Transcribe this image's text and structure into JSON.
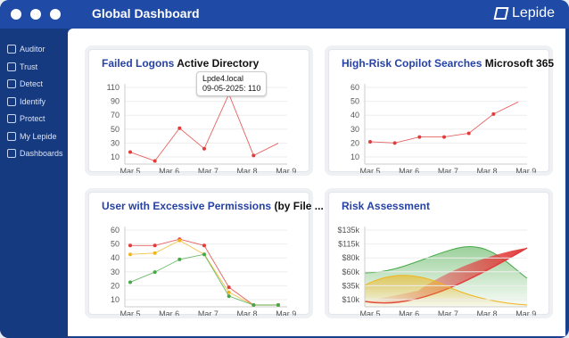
{
  "app": {
    "title": "Global Dashboard",
    "brand": "Lepide"
  },
  "sidebar": {
    "items": [
      {
        "label": "Auditor",
        "icon": "eye-icon"
      },
      {
        "label": "Trust",
        "icon": "shield-icon"
      },
      {
        "label": "Detect",
        "icon": "radar-icon"
      },
      {
        "label": "Identify",
        "icon": "id-card-icon"
      },
      {
        "label": "Protect",
        "icon": "lock-icon"
      },
      {
        "label": "My Lepide",
        "icon": "user-icon"
      },
      {
        "label": "Dashboards",
        "icon": "globe-icon"
      }
    ]
  },
  "cards": {
    "failed_logons": {
      "title": "Failed Logons",
      "subtitle": "Active Directory"
    },
    "copilot": {
      "title": "High-Risk Copilot Searches",
      "subtitle": "Microsoft 365"
    },
    "excessive": {
      "title": "User with Excessive Permissions",
      "subtitle": "(by File ..."
    },
    "risk": {
      "title": "Risk Assessment",
      "subtitle": ""
    }
  },
  "tooltip": {
    "line1": "Lpde4.local",
    "line2": "09-05-2025: 110"
  },
  "colors": {
    "red": "#e23b3b",
    "green": "#46a846",
    "yellow": "#f0b51e",
    "accent": "#2642a4"
  },
  "chart_data": [
    {
      "type": "line",
      "title": "Failed Logons",
      "xlabels": [
        "Mar 5",
        "Mar 6",
        "Mar 7",
        "Mar 8",
        "Mar 9"
      ],
      "yticks": [
        10,
        30,
        50,
        70,
        90,
        110
      ],
      "ylim": [
        0,
        115
      ],
      "series": [
        {
          "values": [
            15,
            2,
            50,
            20,
            100,
            10,
            28
          ]
        }
      ]
    },
    {
      "type": "line",
      "title": "High-Risk Copilot Searches",
      "xlabels": [
        "Mar 5",
        "Mar 6",
        "Mar 7",
        "Mar 8",
        "Mar 9"
      ],
      "yticks": [
        10,
        20,
        30,
        40,
        50,
        60
      ],
      "ylim": [
        0,
        65
      ],
      "series": [
        {
          "values": [
            17,
            16,
            21,
            21,
            24,
            40,
            50
          ]
        }
      ]
    },
    {
      "type": "line",
      "title": "User with Excessive Permissions",
      "xlabels": [
        "Mar 5",
        "Mar 6",
        "Mar 7",
        "Mar 8",
        "Mar 9"
      ],
      "yticks": [
        10,
        20,
        30,
        40,
        50,
        60
      ],
      "ylim": [
        0,
        62
      ],
      "series": [
        {
          "color": "red",
          "values": [
            47,
            47,
            52,
            47,
            14,
            0,
            0
          ]
        },
        {
          "color": "yellow",
          "values": [
            40,
            41,
            51,
            40,
            10,
            0,
            0
          ]
        },
        {
          "color": "green",
          "values": [
            18,
            26,
            36,
            40,
            7,
            0,
            0
          ]
        }
      ]
    },
    {
      "type": "area",
      "title": "Risk Assessment",
      "xlabels": [
        "Mar 5",
        "Mar 6",
        "Mar 7",
        "Mar 8",
        "Mar 9"
      ],
      "yticks": [
        "$10k",
        "$35k",
        "$60k",
        "$80k",
        "$115k",
        "$135k"
      ],
      "series": [
        {
          "name": "",
          "values": []
        }
      ]
    }
  ]
}
